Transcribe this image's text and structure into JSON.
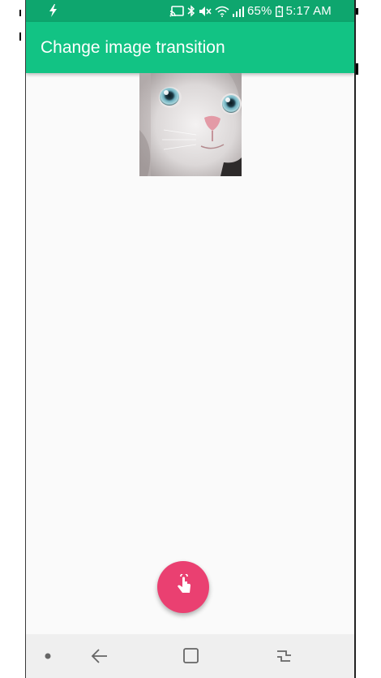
{
  "status_bar": {
    "battery": "65%",
    "time": "5:17 AM",
    "icons": [
      "charging-icon",
      "cast-icon",
      "bluetooth-icon",
      "mute-icon",
      "wifi-icon",
      "signal-icon",
      "battery-icon"
    ]
  },
  "app_bar": {
    "title": "Change image transition"
  },
  "content": {
    "image": "kitten-image"
  },
  "fab": {
    "icon": "touch-hand-icon"
  },
  "nav_bar": {
    "items": [
      "recents-dot",
      "back-icon",
      "home-icon",
      "overview-icon"
    ]
  },
  "colors": {
    "status_bar": "#0ea66e",
    "app_bar": "#12c384",
    "fab": "#ea4071",
    "background": "#fafafa",
    "nav_bar": "#efefef"
  }
}
